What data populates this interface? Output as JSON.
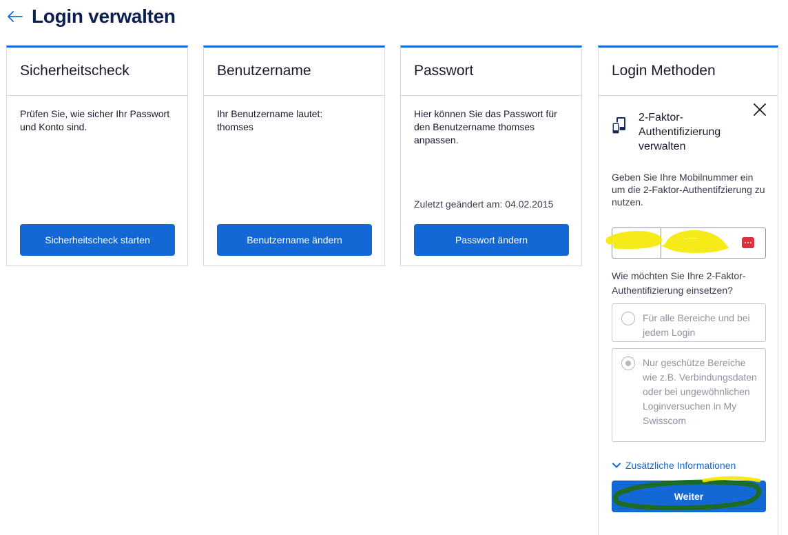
{
  "page": {
    "title": "Login verwalten",
    "back_icon": "arrow-left-icon"
  },
  "cards": {
    "security": {
      "title": "Sicherheitscheck",
      "text": "Prüfen Sie, wie sicher Ihr Passwort und Konto sind.",
      "button": "Sicherheitscheck starten"
    },
    "username": {
      "title": "Benutzername",
      "text": "Ihr Benutzername lautet: thomses",
      "button": "Benutzername ändern"
    },
    "password": {
      "title": "Passwort",
      "text": "Hier können Sie das Passwort für den Benutzername thomses anpassen.",
      "note": "Zuletzt geändert am: 04.02.2015",
      "button": "Passwort ändern"
    },
    "login_methods": {
      "title": "Login Methoden",
      "tfa_title": "2-Faktor-Authentifizierung verwalten",
      "hint": "Geben Sie Ihre Mobilnummer ein um die 2-Faktor-Authentifzierung zu nutzen.",
      "phone_prefix": "",
      "phone_number": "",
      "question": "Wie möchten Sie Ihre 2-Faktor-Authentifizierung einsetzen?",
      "options": [
        {
          "label": "Für alle Bereiche und bei jedem Login",
          "selected": false
        },
        {
          "label": "Nur geschütze Bereiche wie z.B. Verbindungsdaten oder bei ungewöhnlichen Loginversuchen in My Swisscom",
          "selected": true
        }
      ],
      "more_info": "Zusätzliche Informationen",
      "next_button": "Weiter"
    }
  },
  "colors": {
    "primary": "#1368d6",
    "title": "#0d1f4f",
    "border": "#d6d9de",
    "highlight_yellow": "#f5e800",
    "highlight_green": "#1f6b1f",
    "badge_red": "#e0303b"
  }
}
